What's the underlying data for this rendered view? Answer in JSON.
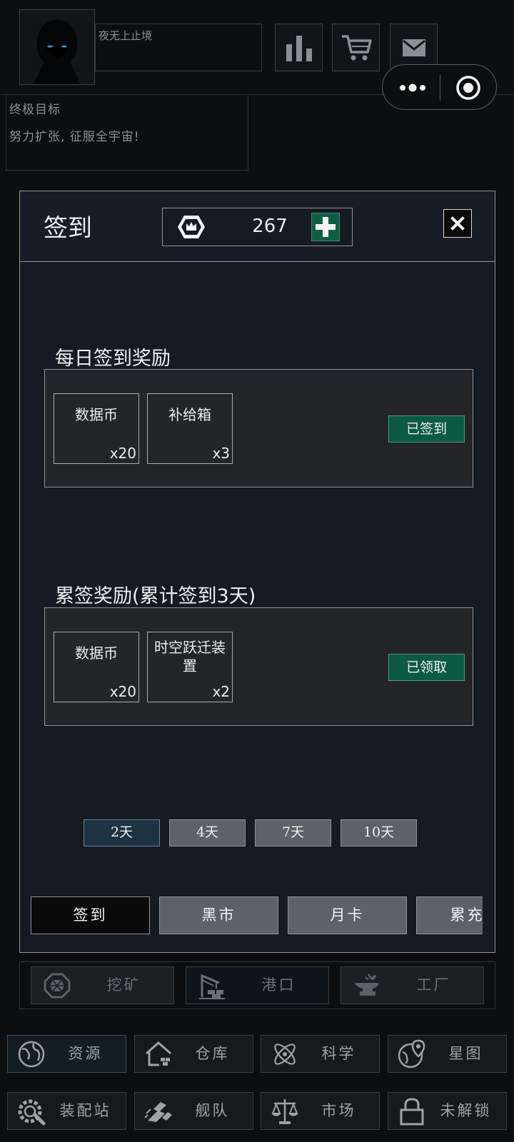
{
  "profile": {
    "player_name": "夜无上止境",
    "avatar_icon": "hooded-figure-avatar"
  },
  "top_icons": [
    "stats-bar-icon",
    "cart-icon",
    "mail-icon"
  ],
  "capsule": {
    "more_icon": "more-dots-icon",
    "close_icon": "target-circle-icon"
  },
  "goal": {
    "title": "终极目标",
    "description": "努力扩张, 征服全宇宙!"
  },
  "checkin": {
    "title": "签到",
    "currency": {
      "icon": "crown-coin-icon",
      "amount": "267",
      "add_icon": "plus-icon"
    },
    "close_icon": "close-icon",
    "daily": {
      "title": "每日签到奖励",
      "items": [
        {
          "name": "数据币",
          "qty": "x20"
        },
        {
          "name": "补给箱",
          "qty": "x3"
        }
      ],
      "status": "已签到"
    },
    "cumulative": {
      "title": "累签奖励(累计签到3天)",
      "items": [
        {
          "name": "数据币",
          "qty": "x20"
        },
        {
          "name": "时空跃迁装置",
          "qty": "x2"
        }
      ],
      "status": "已领取"
    },
    "day_tabs": [
      {
        "label": "2天",
        "active": true
      },
      {
        "label": "4天",
        "active": false
      },
      {
        "label": "7天",
        "active": false
      },
      {
        "label": "10天",
        "active": false
      }
    ],
    "shop_tabs": [
      {
        "label": "签到",
        "active": true
      },
      {
        "label": "黑市",
        "active": false
      },
      {
        "label": "月卡",
        "active": false
      },
      {
        "label": "累充奖",
        "active": false
      }
    ]
  },
  "subnav": [
    {
      "label": "挖矿",
      "icon": "mining-gem-icon",
      "active": false
    },
    {
      "label": "港口",
      "icon": "port-crane-icon",
      "active": true
    },
    {
      "label": "工厂",
      "icon": "anvil-factory-icon",
      "active": false
    }
  ],
  "bottom_nav": [
    {
      "label": "资源",
      "icon": "globe-icon",
      "active": true
    },
    {
      "label": "仓库",
      "icon": "warehouse-icon",
      "active": false
    },
    {
      "label": "科学",
      "icon": "atom-icon",
      "active": false
    },
    {
      "label": "星图",
      "icon": "star-map-icon",
      "active": false
    },
    {
      "label": "装配站",
      "icon": "wrench-gear-icon",
      "active": false
    },
    {
      "label": "舰队",
      "icon": "fleet-icon",
      "active": false
    },
    {
      "label": "市场",
      "icon": "scales-icon",
      "active": false
    },
    {
      "label": "未解锁",
      "icon": "lock-icon",
      "active": false
    }
  ]
}
